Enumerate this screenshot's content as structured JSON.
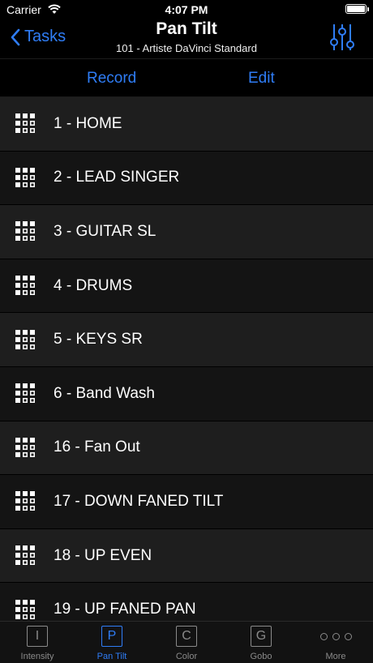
{
  "status": {
    "carrier": "Carrier",
    "time": "4:07 PM"
  },
  "nav": {
    "back_label": "Tasks",
    "title": "Pan Tilt",
    "subtitle": "101 - Artiste DaVinci Standard"
  },
  "toolbar": {
    "record_label": "Record",
    "edit_label": "Edit"
  },
  "list": {
    "items": [
      "1 - HOME",
      "2 - LEAD SINGER",
      "3 - GUITAR SL",
      "4 - DRUMS",
      "5 - KEYS SR",
      "6 - Band Wash",
      "16 - Fan Out",
      "17 - DOWN FANED TILT",
      "18 - UP EVEN",
      "19 - UP FANED PAN"
    ]
  },
  "tabs": [
    {
      "glyph": "I",
      "label": "Intensity",
      "active": false
    },
    {
      "glyph": "P",
      "label": "Pan Tilt",
      "active": true
    },
    {
      "glyph": "C",
      "label": "Color",
      "active": false
    },
    {
      "glyph": "G",
      "label": "Gobo",
      "active": false
    },
    {
      "glyph": "",
      "label": "More",
      "active": false
    }
  ],
  "colors": {
    "accent": "#2f7df6",
    "row_odd": "#1e1e1e",
    "row_even": "#141414",
    "tab_inactive": "#8a8a8a"
  }
}
